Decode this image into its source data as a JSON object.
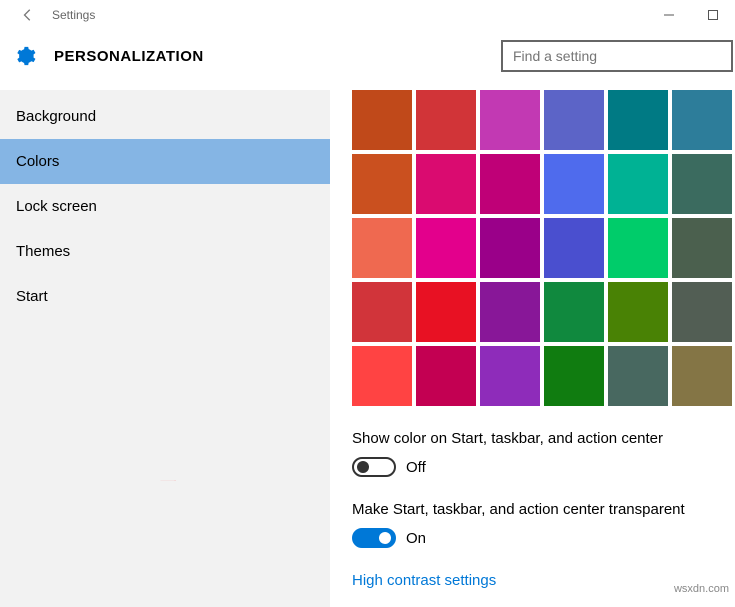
{
  "window": {
    "title": "Settings"
  },
  "page": {
    "title": "PERSONALIZATION"
  },
  "search": {
    "placeholder": "Find a setting"
  },
  "sidebar": {
    "items": [
      "Background",
      "Colors",
      "Lock screen",
      "Themes",
      "Start"
    ],
    "active_index": 1
  },
  "colors": {
    "swatches": [
      [
        "#c0491a",
        "#d13438",
        "#c239b3",
        "#5c64c7",
        "#007a84",
        "#2d7d9a"
      ],
      [
        "#ca501f",
        "#da0b70",
        "#bf0077",
        "#4f6bed",
        "#00b294",
        "#3b6b5f"
      ],
      [
        "#ef6950",
        "#e3008c",
        "#9a0089",
        "#4a4fcf",
        "#00cc6a",
        "#4b604e"
      ],
      [
        "#d1343a",
        "#e81123",
        "#881798",
        "#10893e",
        "#498205",
        "#525e54"
      ],
      [
        "#ff4343",
        "#c30052",
        "#8e2cba",
        "#107c10",
        "#486860",
        "#847545"
      ]
    ],
    "show_color_label": "Show color on Start, taskbar, and action center",
    "show_color_state": "Off",
    "transparent_label": "Make Start, taskbar, and action center transparent",
    "transparent_state": "On",
    "hc_link": "High contrast settings"
  },
  "watermark": "wsxdn.com"
}
